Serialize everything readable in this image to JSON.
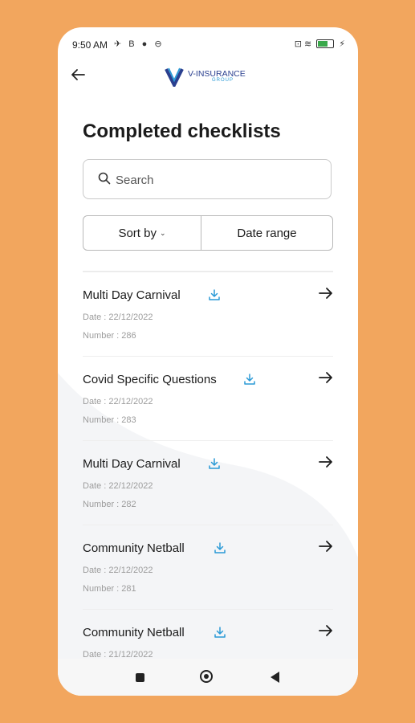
{
  "status": {
    "time": "9:50 AM",
    "left_icons": "✈ B ● ⊖",
    "right_icons": "⊡ ≋",
    "battery_level": 0.7
  },
  "header": {
    "logo_name": "V-INSURANCE",
    "logo_sub": "GROUP"
  },
  "page": {
    "title": "Completed checklists"
  },
  "search": {
    "placeholder": "Search"
  },
  "filters": {
    "sort_label": "Sort by",
    "date_label": "Date range"
  },
  "checklists": [
    {
      "name": "Multi Day Carnival",
      "date": "Date : 22/12/2022",
      "number": "Number : 286"
    },
    {
      "name": "Covid Specific Questions",
      "date": "Date : 22/12/2022",
      "number": "Number : 283"
    },
    {
      "name": "Multi Day Carnival",
      "date": "Date : 22/12/2022",
      "number": "Number : 282"
    },
    {
      "name": "Community Netball",
      "date": "Date : 22/12/2022",
      "number": "Number : 281"
    },
    {
      "name": "Community Netball",
      "date": "Date : 21/12/2022",
      "number": ""
    }
  ],
  "colors": {
    "background": "#F2A65E",
    "accent": "#2a9ad6",
    "logo": "#2a3f8f"
  }
}
